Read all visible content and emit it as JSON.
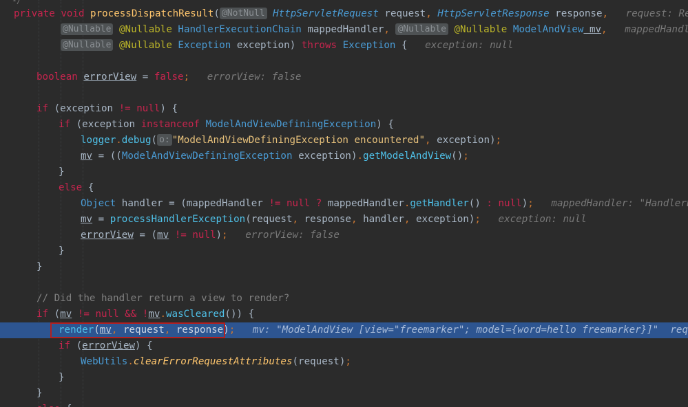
{
  "editor": {
    "top_fragment": "*/",
    "lines": [
      {
        "segments": [
          {
            "t": "private void ",
            "c": "kwp"
          },
          {
            "t": "processDispatchResult",
            "c": "fn"
          },
          {
            "t": "(",
            "c": ""
          },
          {
            "t": "@NotNull",
            "c": "badge"
          },
          {
            "t": " HttpServletRequest",
            "c": "typ"
          },
          {
            "t": " request",
            "c": ""
          },
          {
            "t": ", ",
            "c": "punct"
          },
          {
            "t": "HttpServletResponse",
            "c": "typ"
          },
          {
            "t": " response",
            "c": ""
          },
          {
            "t": ",",
            "c": "punct"
          },
          {
            "t": "   request: RequestFa",
            "c": "inl"
          }
        ]
      },
      {
        "segments": [
          {
            "t": "@Nullable",
            "c": "badge"
          },
          {
            "t": " @Nullable",
            "c": "anno"
          },
          {
            "t": " HandlerExecutionChain",
            "c": "cls"
          },
          {
            "t": " mappedHandler",
            "c": ""
          },
          {
            "t": ", ",
            "c": "punct"
          },
          {
            "t": "@Nullable",
            "c": "badge"
          },
          {
            "t": " @Nullable",
            "c": "anno"
          },
          {
            "t": " ModelAndView",
            "c": "cls"
          },
          {
            "t": " mv",
            "c": "ul"
          },
          {
            "t": ",",
            "c": "punct"
          },
          {
            "t": "   mappedHandler: \"Ha",
            "c": "inl"
          }
        ]
      },
      {
        "segments": [
          {
            "t": "@Nullable",
            "c": "badge"
          },
          {
            "t": " @Nullable",
            "c": "anno"
          },
          {
            "t": " Exception",
            "c": "cls"
          },
          {
            "t": " exception) ",
            "c": ""
          },
          {
            "t": "throws ",
            "c": "kwp"
          },
          {
            "t": "Exception",
            "c": "cls"
          },
          {
            "t": " {",
            "c": ""
          },
          {
            "t": "   exception: null",
            "c": "inl"
          }
        ]
      },
      {
        "segments": []
      },
      {
        "segments": [
          {
            "t": "boolean ",
            "c": "kwp"
          },
          {
            "t": "errorView",
            "c": "ul"
          },
          {
            "t": " = ",
            "c": ""
          },
          {
            "t": "false",
            "c": "kwp"
          },
          {
            "t": ";",
            "c": "punct"
          },
          {
            "t": "   errorView: false",
            "c": "inl"
          }
        ]
      },
      {
        "segments": []
      },
      {
        "segments": [
          {
            "t": "if ",
            "c": "kwp"
          },
          {
            "t": "(exception ",
            "c": ""
          },
          {
            "t": "!=",
            "c": "kwp"
          },
          {
            "t": " ",
            "c": ""
          },
          {
            "t": "null",
            "c": "kwp"
          },
          {
            "t": ") {",
            "c": ""
          }
        ]
      },
      {
        "segments": [
          {
            "t": "if ",
            "c": "kwp"
          },
          {
            "t": "(exception ",
            "c": ""
          },
          {
            "t": "instanceof ",
            "c": "kwp"
          },
          {
            "t": "ModelAndViewDefiningException",
            "c": "cls"
          },
          {
            "t": ") {",
            "c": ""
          }
        ]
      },
      {
        "segments": [
          {
            "t": "logger",
            "c": "mem"
          },
          {
            "t": ".",
            "c": "punct"
          },
          {
            "t": "debug",
            "c": "mem"
          },
          {
            "t": "(",
            "c": ""
          },
          {
            "t": "o:",
            "c": "badge"
          },
          {
            "t": "\"ModelAndViewDefiningException encountered\"",
            "c": "str2"
          },
          {
            "t": ", ",
            "c": "punct"
          },
          {
            "t": "exception)",
            "c": ""
          },
          {
            "t": ";",
            "c": "punct"
          }
        ]
      },
      {
        "segments": [
          {
            "t": "mv",
            "c": "ul"
          },
          {
            "t": " = ((",
            "c": ""
          },
          {
            "t": "ModelAndViewDefiningException",
            "c": "cls"
          },
          {
            "t": " exception)",
            "c": ""
          },
          {
            "t": ".",
            "c": "punct"
          },
          {
            "t": "getModelAndView",
            "c": "mem"
          },
          {
            "t": "()",
            "c": ""
          },
          {
            "t": ";",
            "c": "punct"
          }
        ]
      },
      {
        "segments": [
          {
            "t": "}",
            "c": ""
          }
        ]
      },
      {
        "segments": [
          {
            "t": "else ",
            "c": "kwp"
          },
          {
            "t": "{",
            "c": ""
          }
        ]
      },
      {
        "segments": [
          {
            "t": "Object",
            "c": "cls"
          },
          {
            "t": " handler = (mappedHandler ",
            "c": ""
          },
          {
            "t": "!=",
            "c": "kwp"
          },
          {
            "t": " ",
            "c": ""
          },
          {
            "t": "null",
            "c": "kwp"
          },
          {
            "t": " ? ",
            "c": "kwp"
          },
          {
            "t": "mappedHandler",
            "c": ""
          },
          {
            "t": ".",
            "c": "punct"
          },
          {
            "t": "getHandler",
            "c": "mem"
          },
          {
            "t": "()",
            "c": ""
          },
          {
            "t": " : ",
            "c": "kwp"
          },
          {
            "t": "null",
            "c": "kwp"
          },
          {
            "t": ")",
            "c": ""
          },
          {
            "t": ";",
            "c": "punct"
          },
          {
            "t": "   mappedHandler: \"HandlerExecutio",
            "c": "inl"
          }
        ]
      },
      {
        "segments": [
          {
            "t": "mv",
            "c": "ul"
          },
          {
            "t": " = ",
            "c": ""
          },
          {
            "t": "processHandlerException",
            "c": "mem"
          },
          {
            "t": "(request",
            "c": ""
          },
          {
            "t": ", ",
            "c": "punct"
          },
          {
            "t": "response",
            "c": ""
          },
          {
            "t": ", ",
            "c": "punct"
          },
          {
            "t": "handler",
            "c": ""
          },
          {
            "t": ", ",
            "c": "punct"
          },
          {
            "t": "exception)",
            "c": ""
          },
          {
            "t": ";",
            "c": "punct"
          },
          {
            "t": "   exception: null",
            "c": "inl"
          }
        ]
      },
      {
        "segments": [
          {
            "t": "errorView",
            "c": "ul"
          },
          {
            "t": " = (",
            "c": ""
          },
          {
            "t": "mv",
            "c": "ul"
          },
          {
            "t": " ",
            "c": ""
          },
          {
            "t": "!=",
            "c": "kwp"
          },
          {
            "t": " ",
            "c": ""
          },
          {
            "t": "null",
            "c": "kwp"
          },
          {
            "t": ")",
            "c": ""
          },
          {
            "t": ";",
            "c": "punct"
          },
          {
            "t": "   errorView: false",
            "c": "inl"
          }
        ]
      },
      {
        "segments": [
          {
            "t": "}",
            "c": ""
          }
        ]
      },
      {
        "segments": [
          {
            "t": "}",
            "c": ""
          }
        ]
      },
      {
        "segments": []
      },
      {
        "segments": [
          {
            "t": "// Did the handler return a view to render?",
            "c": "cmt"
          }
        ]
      },
      {
        "segments": [
          {
            "t": "if ",
            "c": "kwp"
          },
          {
            "t": "(",
            "c": ""
          },
          {
            "t": "mv",
            "c": "ul"
          },
          {
            "t": " ",
            "c": ""
          },
          {
            "t": "!=",
            "c": "kwp"
          },
          {
            "t": " ",
            "c": ""
          },
          {
            "t": "null",
            "c": "kwp"
          },
          {
            "t": " ",
            "c": ""
          },
          {
            "t": "&&",
            "c": "kwp"
          },
          {
            "t": " !",
            "c": "kwp"
          },
          {
            "t": "mv",
            "c": "ul"
          },
          {
            "t": ".",
            "c": "punct"
          },
          {
            "t": "wasCleared",
            "c": "mem"
          },
          {
            "t": "()) {",
            "c": ""
          }
        ]
      },
      {
        "segments": [
          {
            "t": "render",
            "c": "mem"
          },
          {
            "t": "(",
            "c": ""
          },
          {
            "t": "mv",
            "c": "ul"
          },
          {
            "t": ", ",
            "c": "punct"
          },
          {
            "t": "request",
            "c": ""
          },
          {
            "t": ", ",
            "c": "punct"
          },
          {
            "t": "response)",
            "c": ""
          },
          {
            "t": ";",
            "c": "punct"
          },
          {
            "t": "   mv: \"ModelAndView [view=\"freemarker\"; model={word=hello freemarker}]\"  request: Re",
            "c": "inl"
          }
        ]
      },
      {
        "segments": [
          {
            "t": "if ",
            "c": "kwp"
          },
          {
            "t": "(",
            "c": ""
          },
          {
            "t": "errorView",
            "c": "ul"
          },
          {
            "t": ") {",
            "c": ""
          }
        ]
      },
      {
        "segments": [
          {
            "t": "WebUtils",
            "c": "cls"
          },
          {
            "t": ".",
            "c": "punct"
          },
          {
            "t": "clearErrorRequestAttributes",
            "c": "fn2"
          },
          {
            "t": "(request)",
            "c": ""
          },
          {
            "t": ";",
            "c": "punct"
          }
        ]
      },
      {
        "segments": [
          {
            "t": "}",
            "c": ""
          }
        ]
      },
      {
        "segments": [
          {
            "t": "}",
            "c": ""
          }
        ]
      },
      {
        "segments": [
          {
            "t": "else ",
            "c": "kwp"
          },
          {
            "t": "{",
            "c": ""
          }
        ]
      }
    ]
  },
  "colors": {
    "background": "#2b2b2b",
    "execution_line": "#2d5591",
    "highlight_box": "#b32020"
  }
}
